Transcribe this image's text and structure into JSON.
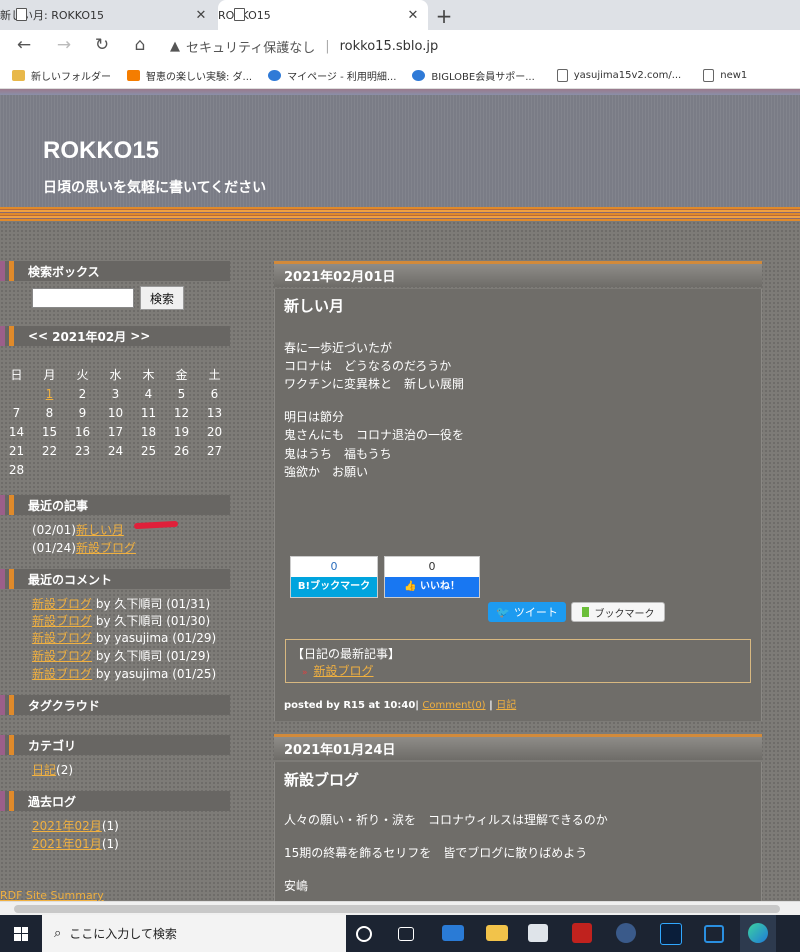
{
  "browser": {
    "tabs": [
      {
        "title": "新しい月: ROKKO15",
        "active": false
      },
      {
        "title": "ROKKO15",
        "active": true
      }
    ],
    "new_tab_symbol": "+",
    "security_label": "セキュリティ保護なし",
    "url": "rokko15.sblo.jp",
    "bookmarks": [
      {
        "label": "新しいフォルダー",
        "icon": "folder-icon"
      },
      {
        "label": "智恵の楽しい実験: ダ...",
        "icon": "blogger-icon"
      },
      {
        "label": "マイページ - 利用明細...",
        "icon": "globe-icon"
      },
      {
        "label": "BIGLOBE会員サポー...",
        "icon": "globe-icon"
      },
      {
        "label": "yasujima15v2.com/...",
        "icon": "page-icon"
      },
      {
        "label": "new1",
        "icon": "page-icon"
      }
    ]
  },
  "site": {
    "title": "ROKKO15",
    "description": "日頃の思いを気軽に書いてください"
  },
  "sidebar": {
    "search": {
      "heading": "検索ボックス",
      "button": "検索",
      "value": ""
    },
    "calendar": {
      "prev": "<<",
      "month": "2021年02月",
      "next": ">>",
      "weekdays": [
        "日",
        "月",
        "火",
        "水",
        "木",
        "金",
        "土"
      ],
      "weeks": [
        [
          "",
          "1",
          "2",
          "3",
          "4",
          "5",
          "6"
        ],
        [
          "7",
          "8",
          "9",
          "10",
          "11",
          "12",
          "13"
        ],
        [
          "14",
          "15",
          "16",
          "17",
          "18",
          "19",
          "20"
        ],
        [
          "21",
          "22",
          "23",
          "24",
          "25",
          "26",
          "27"
        ],
        [
          "28",
          "",
          "",
          "",
          "",
          "",
          ""
        ]
      ],
      "linked_day": "1"
    },
    "recent_posts": {
      "heading": "最近の記事",
      "items": [
        {
          "date": "(02/01)",
          "title": "新しい月"
        },
        {
          "date": "(01/24)",
          "title": "新設ブログ"
        }
      ]
    },
    "recent_comments": {
      "heading": "最近のコメント",
      "items": [
        {
          "post": "新設ブログ",
          "by": "by 久下順司 (01/31)"
        },
        {
          "post": "新設ブログ",
          "by": "by 久下順司 (01/30)"
        },
        {
          "post": "新設ブログ",
          "by": "by yasujima (01/29)"
        },
        {
          "post": "新設ブログ",
          "by": "by 久下順司 (01/29)"
        },
        {
          "post": "新設ブログ",
          "by": "by yasujima (01/25)"
        }
      ]
    },
    "tag_cloud": {
      "heading": "タグクラウド"
    },
    "categories": {
      "heading": "カテゴリ",
      "items": [
        {
          "name": "日記",
          "count": "(2)"
        }
      ]
    },
    "archives": {
      "heading": "過去ログ",
      "items": [
        {
          "name": "2021年02月",
          "count": "(1)"
        },
        {
          "name": "2021年01月",
          "count": "(1)"
        }
      ]
    },
    "rdf": "RDF Site Summary"
  },
  "posts": [
    {
      "date": "2021年02月01日",
      "title": "新しい月",
      "lines": [
        "春に一歩近づいたが",
        "コロナは　どうなるのだろうか",
        "ワクチンに変異株と　新しい展開",
        "",
        "明日は節分",
        "鬼さんにも　コロナ退治の一役を",
        "鬼はうち　福もうち",
        "強欲か　お願い"
      ],
      "hatena": {
        "count": "0",
        "label": "B!ブックマーク"
      },
      "facebook": {
        "count": "0",
        "label": "いいね！"
      },
      "tweet": "ツイート",
      "bookmark": "ブックマーク",
      "latest_box": {
        "heading": "【日記の最新記事】",
        "items": [
          "新設ブログ"
        ]
      },
      "info": {
        "prefix": "posted by R15 at 10:40|",
        "comment": "Comment(0)",
        "sep": "|",
        "category": "日記"
      }
    },
    {
      "date": "2021年01月24日",
      "title": "新設ブログ",
      "lines": [
        "人々の願い・祈り・涙を　コロナウィルスは理解できるのか",
        "15期の終幕を飾るセリフを　皆でブログに散りばめよう",
        "安嶋"
      ]
    }
  ],
  "taskbar": {
    "search_placeholder": "ここに入力して検索",
    "apps": [
      "cortana-icon",
      "task-view-icon",
      "mail-icon",
      "file-explorer-icon",
      "store-icon",
      "filezilla-icon",
      "app-icon",
      "photoshop-icon",
      "window-icon",
      "edge-icon"
    ]
  }
}
